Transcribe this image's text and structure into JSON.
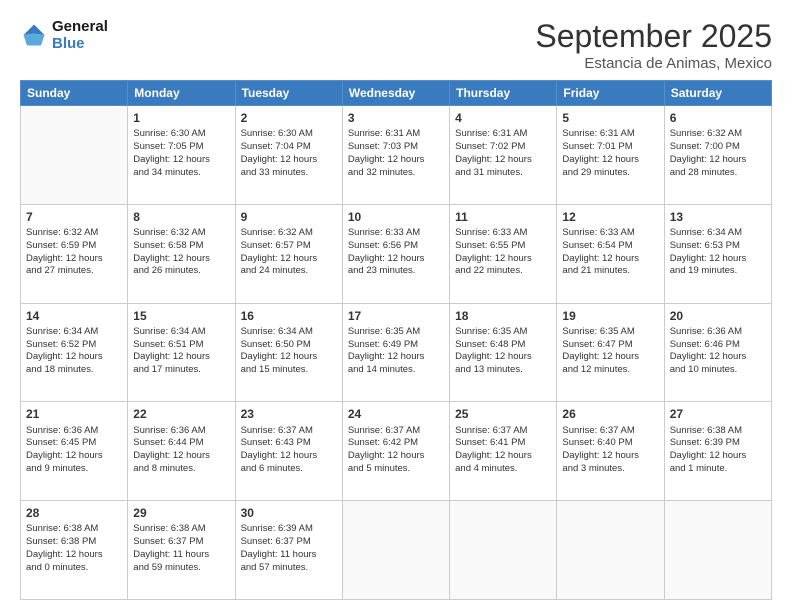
{
  "logo": {
    "line1": "General",
    "line2": "Blue"
  },
  "header": {
    "month": "September 2025",
    "location": "Estancia de Animas, Mexico"
  },
  "weekdays": [
    "Sunday",
    "Monday",
    "Tuesday",
    "Wednesday",
    "Thursday",
    "Friday",
    "Saturday"
  ],
  "weeks": [
    [
      {
        "day": "",
        "content": ""
      },
      {
        "day": "1",
        "content": "Sunrise: 6:30 AM\nSunset: 7:05 PM\nDaylight: 12 hours\nand 34 minutes."
      },
      {
        "day": "2",
        "content": "Sunrise: 6:30 AM\nSunset: 7:04 PM\nDaylight: 12 hours\nand 33 minutes."
      },
      {
        "day": "3",
        "content": "Sunrise: 6:31 AM\nSunset: 7:03 PM\nDaylight: 12 hours\nand 32 minutes."
      },
      {
        "day": "4",
        "content": "Sunrise: 6:31 AM\nSunset: 7:02 PM\nDaylight: 12 hours\nand 31 minutes."
      },
      {
        "day": "5",
        "content": "Sunrise: 6:31 AM\nSunset: 7:01 PM\nDaylight: 12 hours\nand 29 minutes."
      },
      {
        "day": "6",
        "content": "Sunrise: 6:32 AM\nSunset: 7:00 PM\nDaylight: 12 hours\nand 28 minutes."
      }
    ],
    [
      {
        "day": "7",
        "content": "Sunrise: 6:32 AM\nSunset: 6:59 PM\nDaylight: 12 hours\nand 27 minutes."
      },
      {
        "day": "8",
        "content": "Sunrise: 6:32 AM\nSunset: 6:58 PM\nDaylight: 12 hours\nand 26 minutes."
      },
      {
        "day": "9",
        "content": "Sunrise: 6:32 AM\nSunset: 6:57 PM\nDaylight: 12 hours\nand 24 minutes."
      },
      {
        "day": "10",
        "content": "Sunrise: 6:33 AM\nSunset: 6:56 PM\nDaylight: 12 hours\nand 23 minutes."
      },
      {
        "day": "11",
        "content": "Sunrise: 6:33 AM\nSunset: 6:55 PM\nDaylight: 12 hours\nand 22 minutes."
      },
      {
        "day": "12",
        "content": "Sunrise: 6:33 AM\nSunset: 6:54 PM\nDaylight: 12 hours\nand 21 minutes."
      },
      {
        "day": "13",
        "content": "Sunrise: 6:34 AM\nSunset: 6:53 PM\nDaylight: 12 hours\nand 19 minutes."
      }
    ],
    [
      {
        "day": "14",
        "content": "Sunrise: 6:34 AM\nSunset: 6:52 PM\nDaylight: 12 hours\nand 18 minutes."
      },
      {
        "day": "15",
        "content": "Sunrise: 6:34 AM\nSunset: 6:51 PM\nDaylight: 12 hours\nand 17 minutes."
      },
      {
        "day": "16",
        "content": "Sunrise: 6:34 AM\nSunset: 6:50 PM\nDaylight: 12 hours\nand 15 minutes."
      },
      {
        "day": "17",
        "content": "Sunrise: 6:35 AM\nSunset: 6:49 PM\nDaylight: 12 hours\nand 14 minutes."
      },
      {
        "day": "18",
        "content": "Sunrise: 6:35 AM\nSunset: 6:48 PM\nDaylight: 12 hours\nand 13 minutes."
      },
      {
        "day": "19",
        "content": "Sunrise: 6:35 AM\nSunset: 6:47 PM\nDaylight: 12 hours\nand 12 minutes."
      },
      {
        "day": "20",
        "content": "Sunrise: 6:36 AM\nSunset: 6:46 PM\nDaylight: 12 hours\nand 10 minutes."
      }
    ],
    [
      {
        "day": "21",
        "content": "Sunrise: 6:36 AM\nSunset: 6:45 PM\nDaylight: 12 hours\nand 9 minutes."
      },
      {
        "day": "22",
        "content": "Sunrise: 6:36 AM\nSunset: 6:44 PM\nDaylight: 12 hours\nand 8 minutes."
      },
      {
        "day": "23",
        "content": "Sunrise: 6:37 AM\nSunset: 6:43 PM\nDaylight: 12 hours\nand 6 minutes."
      },
      {
        "day": "24",
        "content": "Sunrise: 6:37 AM\nSunset: 6:42 PM\nDaylight: 12 hours\nand 5 minutes."
      },
      {
        "day": "25",
        "content": "Sunrise: 6:37 AM\nSunset: 6:41 PM\nDaylight: 12 hours\nand 4 minutes."
      },
      {
        "day": "26",
        "content": "Sunrise: 6:37 AM\nSunset: 6:40 PM\nDaylight: 12 hours\nand 3 minutes."
      },
      {
        "day": "27",
        "content": "Sunrise: 6:38 AM\nSunset: 6:39 PM\nDaylight: 12 hours\nand 1 minute."
      }
    ],
    [
      {
        "day": "28",
        "content": "Sunrise: 6:38 AM\nSunset: 6:38 PM\nDaylight: 12 hours\nand 0 minutes."
      },
      {
        "day": "29",
        "content": "Sunrise: 6:38 AM\nSunset: 6:37 PM\nDaylight: 11 hours\nand 59 minutes."
      },
      {
        "day": "30",
        "content": "Sunrise: 6:39 AM\nSunset: 6:37 PM\nDaylight: 11 hours\nand 57 minutes."
      },
      {
        "day": "",
        "content": ""
      },
      {
        "day": "",
        "content": ""
      },
      {
        "day": "",
        "content": ""
      },
      {
        "day": "",
        "content": ""
      }
    ]
  ]
}
